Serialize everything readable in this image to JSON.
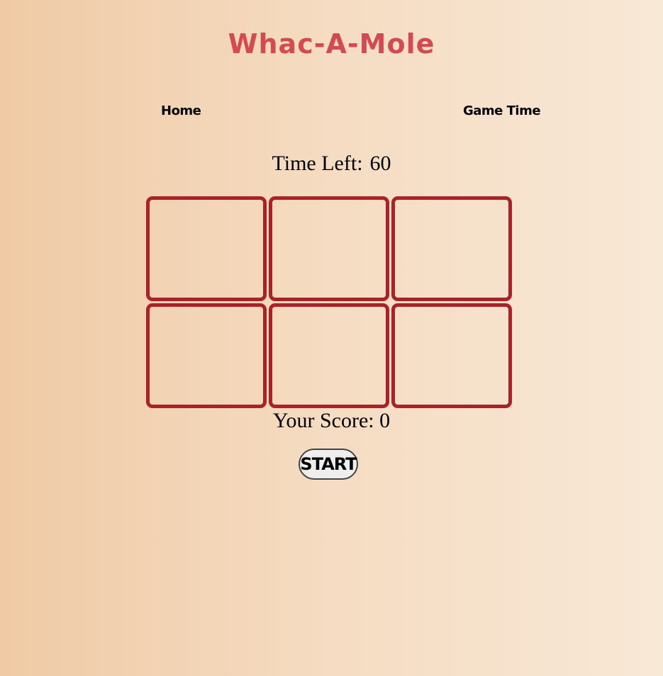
{
  "header": {
    "title": "Whac-A-Mole"
  },
  "nav": {
    "home_label": "Home",
    "game_time_label": "Game Time"
  },
  "timer": {
    "label": "Time Left:",
    "value": "60"
  },
  "board": {
    "holes": [
      "",
      "",
      "",
      "",
      "",
      ""
    ],
    "border_color": "#a82228"
  },
  "score": {
    "label": "Your Score:",
    "value": "0"
  },
  "controls": {
    "start_label": "START"
  },
  "colors": {
    "title": "#d24b52",
    "background_start": "#efcaa5",
    "background_end": "#f8e8d6"
  }
}
